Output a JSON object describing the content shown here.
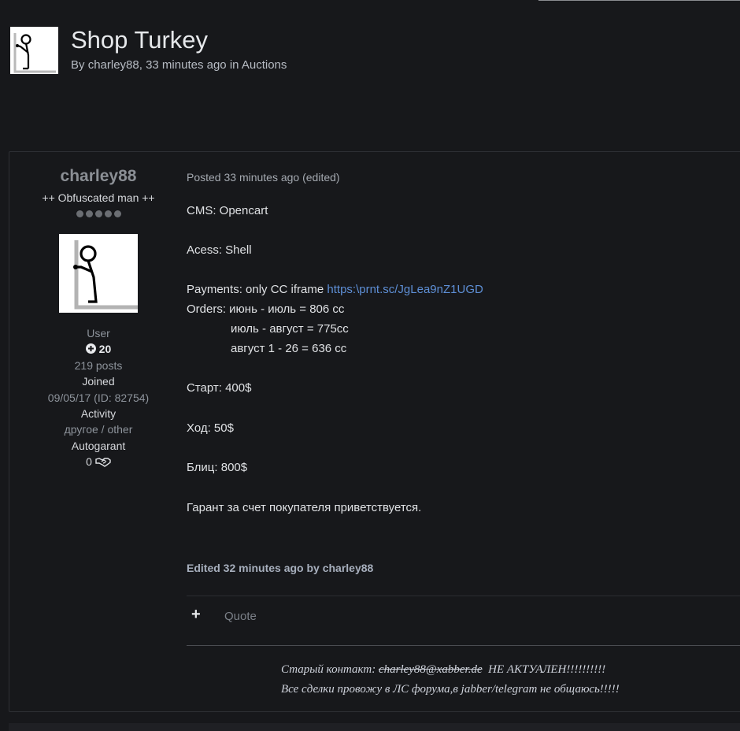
{
  "topic": {
    "title": "Shop Turkey",
    "by_label": "By",
    "author": "charley88",
    "time": "33 minutes ago",
    "in_label": "in",
    "forum": "Auctions"
  },
  "author": {
    "name": "charley88",
    "title": "++ Obfuscated man ++",
    "pips": 5,
    "group": "User",
    "reputation": "20",
    "posts": "219 posts",
    "joined_label": "Joined",
    "joined_value": "09/05/17 (ID: 82754)",
    "activity_label": "Activity",
    "activity_value": "другое / other",
    "autogarant_label": "Autogarant",
    "autogarant_value": "0"
  },
  "post": {
    "posted": "Posted 33 minutes ago (edited)",
    "cms": "CMS: Opencart",
    "access": "Acess: Shell",
    "payments_prefix": "Payments: only CC iframe ",
    "payments_link": "https:\\prnt.sc/JgLea9nZ1UGD",
    "orders_1": "Orders: июнь - июль = 806 cc",
    "orders_2": "июль - август = 775cc",
    "orders_3": "август 1 - 26 = 636 cc",
    "start": "Старт: 400$",
    "step": "Ход: 50$",
    "blitz": "Блиц: 800$",
    "guarantee": "Гарант за счет покупателя приветствуется.",
    "edited": "Edited 32 minutes ago by charley88",
    "plus_label": "+",
    "quote_label": "Quote"
  },
  "signature": {
    "line1_prefix": "Старый контакт: ",
    "line1_struck": "charley88@xabber.de",
    "line1_suffix": "  НЕ АКТУАЛЕН!!!!!!!!!!",
    "line2": "Все сделки провожу в ЛС форума,в jabber/telegram не общаюсь!!!!!"
  },
  "icons": {
    "reputation": "plus-circle-icon",
    "autogarant": "handshake-icon"
  }
}
